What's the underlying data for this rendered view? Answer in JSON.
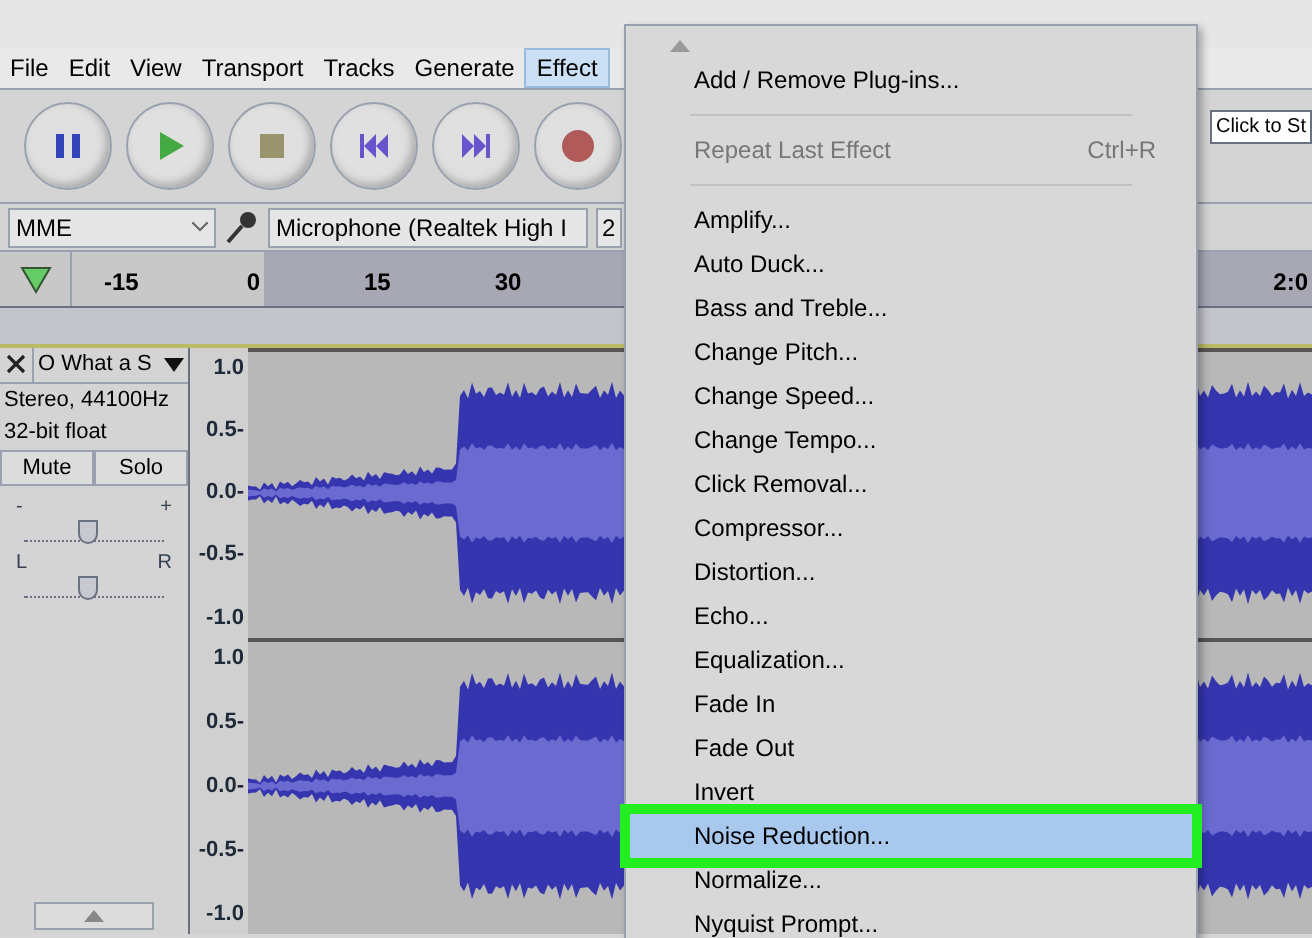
{
  "menu_bar": [
    {
      "label": "File",
      "selected": false
    },
    {
      "label": "Edit",
      "selected": false
    },
    {
      "label": "View",
      "selected": false
    },
    {
      "label": "Transport",
      "selected": false
    },
    {
      "label": "Tracks",
      "selected": false
    },
    {
      "label": "Generate",
      "selected": false
    },
    {
      "label": "Effect",
      "selected": true
    }
  ],
  "transport": [
    {
      "kind": "pause"
    },
    {
      "kind": "play"
    },
    {
      "kind": "stop"
    },
    {
      "kind": "skip-start"
    },
    {
      "kind": "skip-end"
    },
    {
      "kind": "record"
    }
  ],
  "timer_field": {
    "value": "Click to St"
  },
  "device_row": {
    "host": "MME",
    "input": "Microphone (Realtek High I",
    "channels": "2"
  },
  "ruler": {
    "labels": [
      "-15",
      "0",
      "15",
      "30"
    ],
    "far_label": "2:0"
  },
  "track": {
    "name": "O What a S",
    "info": [
      "Stereo, 44100Hz",
      "32-bit float"
    ],
    "buttons": [
      "Mute",
      "Solo"
    ],
    "gain": {
      "low": "-",
      "high": "+",
      "level": 0.45
    },
    "pan": {
      "low": "L",
      "high": "R",
      "level": 0.45
    },
    "channels": [
      {
        "scale": [
          "1.0",
          "0.5-",
          "0.0-",
          "-0.5-",
          "-1.0"
        ]
      },
      {
        "scale": [
          "1.0",
          "0.5-",
          "0.0-",
          "-0.5-",
          "-1.0"
        ]
      }
    ]
  },
  "effect_menu": {
    "items": [
      {
        "kind": "item",
        "label": "Add / Remove Plug-ins...",
        "disabled": false,
        "selected": false
      },
      {
        "kind": "separator"
      },
      {
        "kind": "item",
        "label": "Repeat Last Effect",
        "shortcut": "Ctrl+R",
        "disabled": true,
        "selected": false
      },
      {
        "kind": "separator"
      },
      {
        "kind": "item",
        "label": "Amplify...",
        "disabled": false,
        "selected": false
      },
      {
        "kind": "item",
        "label": "Auto Duck...",
        "disabled": false,
        "selected": false
      },
      {
        "kind": "item",
        "label": "Bass and Treble...",
        "disabled": false,
        "selected": false
      },
      {
        "kind": "item",
        "label": "Change Pitch...",
        "disabled": false,
        "selected": false
      },
      {
        "kind": "item",
        "label": "Change Speed...",
        "disabled": false,
        "selected": false
      },
      {
        "kind": "item",
        "label": "Change Tempo...",
        "disabled": false,
        "selected": false
      },
      {
        "kind": "item",
        "label": "Click Removal...",
        "disabled": false,
        "selected": false
      },
      {
        "kind": "item",
        "label": "Compressor...",
        "disabled": false,
        "selected": false
      },
      {
        "kind": "item",
        "label": "Distortion...",
        "disabled": false,
        "selected": false
      },
      {
        "kind": "item",
        "label": "Echo...",
        "disabled": false,
        "selected": false
      },
      {
        "kind": "item",
        "label": "Equalization...",
        "disabled": false,
        "selected": false
      },
      {
        "kind": "item",
        "label": "Fade In",
        "disabled": false,
        "selected": false
      },
      {
        "kind": "item",
        "label": "Fade Out",
        "disabled": false,
        "selected": false
      },
      {
        "kind": "item",
        "label": "Invert",
        "disabled": false,
        "selected": false
      },
      {
        "kind": "item",
        "label": "Noise Reduction...",
        "disabled": false,
        "selected": true
      },
      {
        "kind": "item",
        "label": "Normalize...",
        "disabled": false,
        "selected": false
      },
      {
        "kind": "item",
        "label": "Nyquist Prompt...",
        "disabled": false,
        "selected": false
      }
    ]
  }
}
